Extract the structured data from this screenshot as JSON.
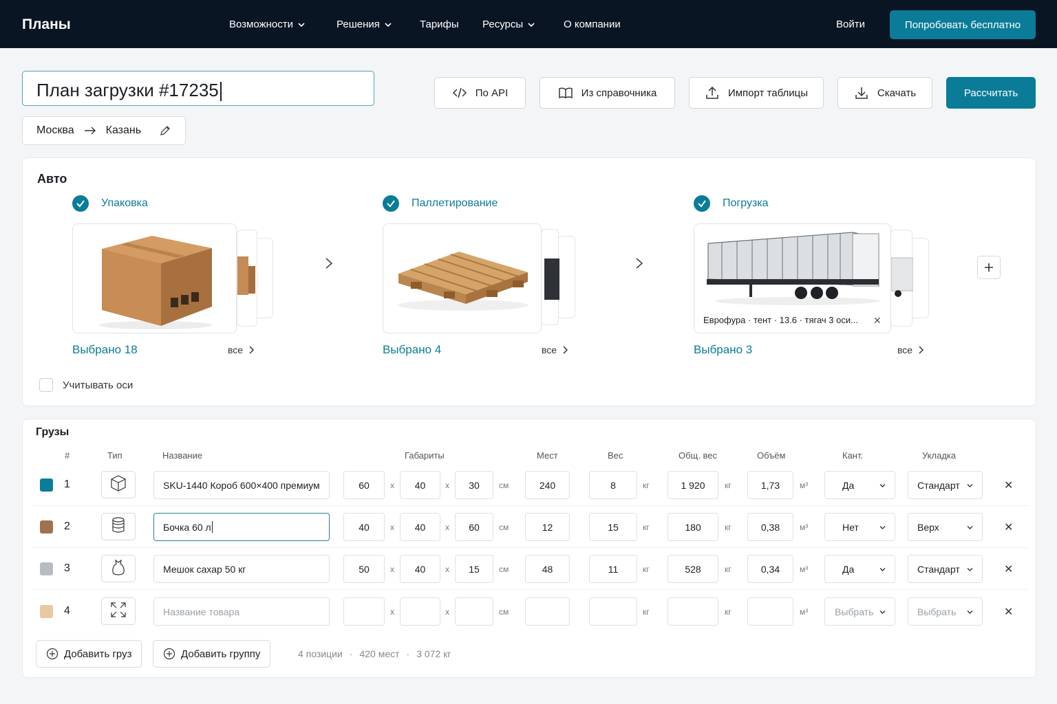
{
  "nav": {
    "brand": "Планы",
    "items": [
      {
        "label": "Возможности",
        "has_dropdown": true
      },
      {
        "label": "Решения",
        "has_dropdown": true
      },
      {
        "label": "Тарифы",
        "has_dropdown": false
      },
      {
        "label": "Ресурсы",
        "has_dropdown": true
      },
      {
        "label": "О компании",
        "has_dropdown": false
      }
    ],
    "login": "Войти",
    "try_free": "Попробовать бесплатно"
  },
  "plan": {
    "title": "План загрузки #17235",
    "route_from": "Москва",
    "route_to": "Казань"
  },
  "toolbar": {
    "api": "По API",
    "catalog": "Из справочника",
    "import": "Импорт таблицы",
    "download": "Скачать",
    "calculate": "Рассчитать"
  },
  "auto": {
    "title": "Авто",
    "steps": [
      {
        "label": "Упаковка",
        "selected": "Выбрано 18",
        "all": "все",
        "image": "cardboard-box"
      },
      {
        "label": "Паллетирование",
        "selected": "Выбрано 4",
        "all": "все",
        "image": "wooden-pallet"
      },
      {
        "label": "Погрузка",
        "selected": "Выбрано 3",
        "all": "все",
        "image": "semi-trailer",
        "caption": "Еврофура · тент · 13.6 · тягач 3 оси..."
      }
    ],
    "axes_label": "Учитывать оси",
    "axes_checked": false
  },
  "cargo": {
    "title": "Грузы",
    "headers": {
      "num": "#",
      "type": "Тип",
      "name": "Название",
      "dims": "Габариты",
      "places": "Мест",
      "weight": "Вес",
      "total_weight": "Общ. вес",
      "volume": "Объём",
      "tilt": "Кант.",
      "stacking": "Укладка"
    },
    "units": {
      "cm": "см",
      "kg": "кг",
      "m3": "м³",
      "x": "x"
    },
    "rows": [
      {
        "num": "1",
        "color": "#0b7d99",
        "type_icon": "box-icon",
        "name": "SKU-1440 Короб 600×400 премиум",
        "l": "60",
        "w": "40",
        "h": "30",
        "places": "240",
        "weight": "8",
        "total": "1 920",
        "volume": "1,73",
        "tilt": "Да",
        "stacking": "Стандарт"
      },
      {
        "num": "2",
        "color": "#a07350",
        "type_icon": "barrel-icon",
        "name": "Бочка 60 л",
        "l": "40",
        "w": "40",
        "h": "60",
        "places": "12",
        "weight": "15",
        "total": "180",
        "volume": "0,38",
        "tilt": "Нет",
        "stacking": "Верх"
      },
      {
        "num": "3",
        "color": "#b8bcc1",
        "type_icon": "sack-icon",
        "name": "Мешок сахар 50 кг",
        "l": "50",
        "w": "40",
        "h": "15",
        "places": "48",
        "weight": "11",
        "total": "528",
        "volume": "0,34",
        "tilt": "Да",
        "stacking": "Стандарт"
      },
      {
        "num": "4",
        "color": "#e8c8a0",
        "type_icon": "expand-icon",
        "name": "",
        "name_placeholder": "Название товара",
        "l": "",
        "w": "",
        "h": "",
        "places": "",
        "weight": "",
        "total": "",
        "volume": "",
        "tilt": "Выбрать",
        "stacking": "Выбрать"
      }
    ],
    "add_cargo": "Добавить груз",
    "add_group": "Добавить группу",
    "summary": [
      "4 позиции",
      "·",
      "420 мест",
      "·",
      "3 072 кг"
    ]
  }
}
